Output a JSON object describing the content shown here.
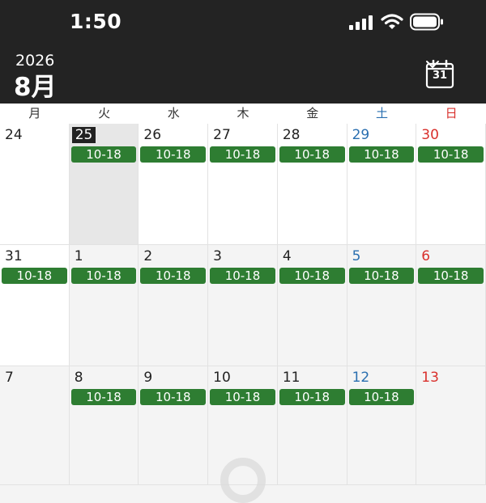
{
  "status_bar": {
    "time": "1:50"
  },
  "header": {
    "year": "2026",
    "month": "8月",
    "calendar_button_day": "31"
  },
  "weekdays": [
    "月",
    "火",
    "水",
    "木",
    "金",
    "土",
    "日"
  ],
  "weeks": [
    [
      {
        "day": "24",
        "event": ""
      },
      {
        "day": "25",
        "event": "10-18"
      },
      {
        "day": "26",
        "event": "10-18"
      },
      {
        "day": "27",
        "event": "10-18"
      },
      {
        "day": "28",
        "event": "10-18"
      },
      {
        "day": "29",
        "event": "10-18"
      },
      {
        "day": "30",
        "event": "10-18"
      }
    ],
    [
      {
        "day": "31",
        "event": "10-18"
      },
      {
        "day": "1",
        "event": "10-18"
      },
      {
        "day": "2",
        "event": "10-18"
      },
      {
        "day": "3",
        "event": "10-18"
      },
      {
        "day": "4",
        "event": "10-18"
      },
      {
        "day": "5",
        "event": "10-18"
      },
      {
        "day": "6",
        "event": "10-18"
      }
    ],
    [
      {
        "day": "7",
        "event": ""
      },
      {
        "day": "8",
        "event": "10-18"
      },
      {
        "day": "9",
        "event": "10-18"
      },
      {
        "day": "10",
        "event": "10-18"
      },
      {
        "day": "11",
        "event": "10-18"
      },
      {
        "day": "12",
        "event": "10-18"
      },
      {
        "day": "13",
        "event": ""
      }
    ]
  ],
  "colors": {
    "event": "#2e7d32",
    "saturday": "#2a6fb0",
    "sunday": "#d9302c",
    "header_bg": "#232323"
  }
}
